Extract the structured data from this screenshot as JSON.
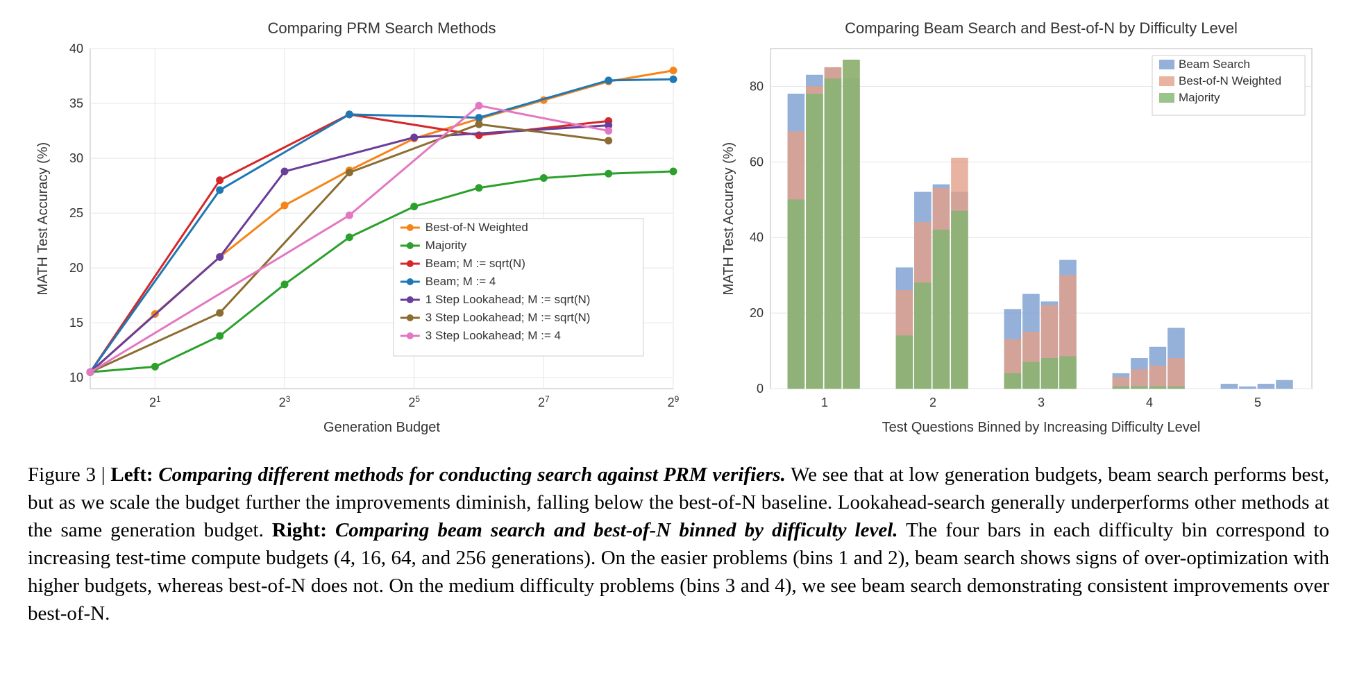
{
  "chart_data": [
    {
      "type": "line",
      "title": "Comparing PRM Search Methods",
      "xlabel": "Generation Budget",
      "ylabel": "MATH Test Accuracy (%)",
      "x": [
        1,
        2,
        4,
        8,
        16,
        32,
        64,
        128,
        256,
        512
      ],
      "xticks_labels": [
        "2¹",
        "2³",
        "2⁵",
        "2⁷",
        "2⁹"
      ],
      "xticks_values": [
        2,
        8,
        32,
        128,
        512
      ],
      "ylim": [
        9,
        40
      ],
      "yticks": [
        10,
        15,
        20,
        25,
        30,
        35,
        40
      ],
      "series": [
        {
          "name": "Best-of-N Weighted",
          "color": "#f58518",
          "x": [
            1,
            2,
            4,
            8,
            16,
            32,
            64,
            128,
            256,
            512
          ],
          "y": [
            10.5,
            15.8,
            21.0,
            25.7,
            28.9,
            31.8,
            33.6,
            35.3,
            37.0,
            38.0
          ]
        },
        {
          "name": "Majority",
          "color": "#2ca02c",
          "x": [
            1,
            2,
            4,
            8,
            16,
            32,
            64,
            128,
            256,
            512
          ],
          "y": [
            10.5,
            11.0,
            13.8,
            18.5,
            22.8,
            25.6,
            27.3,
            28.2,
            28.6,
            28.8
          ]
        },
        {
          "name": "Beam; M := sqrt(N)",
          "color": "#d62728",
          "x": [
            1,
            4,
            16,
            64,
            256
          ],
          "y": [
            10.5,
            28.0,
            34.0,
            32.1,
            33.4
          ]
        },
        {
          "name": "Beam; M := 4",
          "color": "#1f77b4",
          "x": [
            1,
            4,
            16,
            64,
            256,
            512
          ],
          "y": [
            10.5,
            27.1,
            34.0,
            33.7,
            37.1,
            37.2
          ]
        },
        {
          "name": "1 Step Lookahead; M := sqrt(N)",
          "color": "#6a3d9a",
          "x": [
            1,
            4,
            8,
            32,
            256
          ],
          "y": [
            10.5,
            21.0,
            28.8,
            31.9,
            33.0
          ]
        },
        {
          "name": "3 Step Lookahead; M := sqrt(N)",
          "color": "#8c6d31",
          "x": [
            1,
            4,
            16,
            64,
            256
          ],
          "y": [
            10.5,
            15.9,
            28.7,
            33.1,
            31.6
          ]
        },
        {
          "name": "3 Step Lookahead; M := 4",
          "color": "#e377c2",
          "x": [
            1,
            16,
            64,
            256
          ],
          "y": [
            10.5,
            24.8,
            34.8,
            32.5
          ]
        }
      ],
      "legend_pos": "lower-right"
    },
    {
      "type": "bar",
      "title": "Comparing Beam Search and Best-of-N by Difficulty Level",
      "xlabel": "Test Questions Binned by Increasing Difficulty Level",
      "ylabel": "MATH Test Accuracy (%)",
      "ylim": [
        0,
        90
      ],
      "yticks": [
        0,
        20,
        40,
        60,
        80
      ],
      "groups": [
        "1",
        "2",
        "3",
        "4",
        "5"
      ],
      "budgets": [
        4,
        16,
        64,
        256
      ],
      "overlay_series": [
        {
          "name": "Beam Search",
          "color": "#6c8ebf",
          "alpha": 0.75
        },
        {
          "name": "Best-of-N Weighted",
          "color": "#d99694",
          "alpha": 0.78
        },
        {
          "name": "Majority",
          "color": "#93c47d",
          "alpha": 0.82
        }
      ],
      "data": {
        "Beam Search": {
          "1": [
            78,
            83,
            85,
            82
          ],
          "2": [
            32,
            52,
            54,
            52
          ],
          "3": [
            21,
            25,
            23,
            34
          ],
          "4": [
            4,
            8,
            11,
            16
          ],
          "5": [
            1.2,
            0.5,
            1.2,
            2.2
          ]
        },
        "Best-of-N Weighted": {
          "1": [
            68,
            80,
            85,
            87
          ],
          "2": [
            26,
            44,
            53,
            61
          ],
          "3": [
            13,
            15,
            22,
            30
          ],
          "4": [
            3,
            5,
            6,
            8
          ],
          "5": [
            0,
            0,
            0,
            0
          ]
        },
        "Majority": {
          "1": [
            50,
            78,
            82,
            87
          ],
          "2": [
            14,
            28,
            42,
            47
          ],
          "3": [
            4,
            7,
            8,
            8.5
          ],
          "4": [
            0.5,
            0.5,
            0.5,
            0.5
          ],
          "5": [
            0,
            0,
            0,
            0
          ]
        }
      },
      "legend_pos": "upper-right"
    }
  ],
  "caption": {
    "fig_num": "Figure 3",
    "left_heading": "Left:",
    "left_title": "Comparing different methods for conducting search against PRM verifiers.",
    "left_body": " We see that at low generation budgets, beam search performs best, but as we scale the budget further the improvements diminish, falling below the best-of-N baseline. Lookahead-search generally underperforms other methods at the same generation budget. ",
    "right_heading": "Right:",
    "right_title": "Comparing beam search and best-of-N binned by difficulty level.",
    "right_body": " The four bars in each difficulty bin correspond to increasing test-time compute budgets (4, 16, 64, and 256 generations). On the easier problems (bins 1 and 2), beam search shows signs of over-optimization with higher budgets, whereas best-of-N does not. On the medium difficulty problems (bins 3 and 4), we see beam search demonstrating consistent improvements over best-of-N."
  }
}
